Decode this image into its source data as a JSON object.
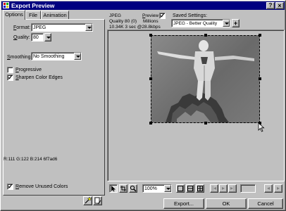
{
  "window": {
    "title": "Export Preview",
    "controls": [
      "?",
      "×"
    ]
  },
  "tabs": [
    {
      "label": "Options",
      "active": true
    },
    {
      "label": "File",
      "active": false
    },
    {
      "label": "Animation",
      "active": false
    }
  ],
  "options": {
    "format_label": "Format:",
    "format_value": "JPEG",
    "quality_label": "Quality:",
    "quality_value": "80",
    "smoothing_label": "Smoothing:",
    "smoothing_value": "No Smoothing",
    "progressive_label": "Progressive",
    "progressive_checked": false,
    "sharpen_label": "Sharpen Color Edges",
    "sharpen_checked": true,
    "rgb_readout": "R:111 G:122 B:214 6f7ad6",
    "remove_unused_label": "Remove Unused Colors",
    "remove_unused_checked": true
  },
  "preview_info": {
    "format": "JPEG",
    "quality": "Quality 80 (0)",
    "size": "10.34K  3 sec @28.8kbps",
    "preview_label": "Preview",
    "preview_checked": true,
    "colors": "Millions",
    "saved_settings_label": "Saved Settings:",
    "saved_settings_value": "JPEG - Better Quality",
    "add_settings": "+"
  },
  "toolbar": {
    "zoom_value": "100%",
    "tools": [
      "pointer-tool",
      "crop-tool",
      "zoom-tool"
    ],
    "views": [
      "single-view",
      "split-2-view",
      "split-4-view"
    ]
  },
  "buttons": {
    "export": "Export...",
    "ok": "OK",
    "cancel": "Cancel"
  }
}
